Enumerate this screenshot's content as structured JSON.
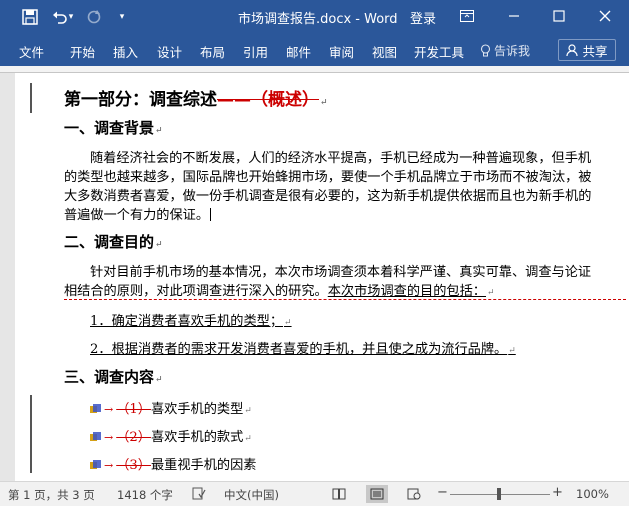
{
  "titlebar": {
    "title": "市场调查报告.docx - Word",
    "login": "登录",
    "icons": [
      "save-icon",
      "undo-icon",
      "redo-icon",
      "customize-quick-access-icon",
      "ribbon-display-options-icon",
      "minimize-icon",
      "maximize-icon",
      "close-icon"
    ],
    "undo_arrow": "▾",
    "customize_arrow": "▾"
  },
  "ribbon": {
    "tabs": [
      "文件",
      "开始",
      "插入",
      "设计",
      "布局",
      "引用",
      "邮件",
      "审阅",
      "视图",
      "开发工具"
    ],
    "tell_me": "告诉我",
    "share": "共享"
  },
  "document": {
    "heading1_main": "第一部分：调查综述",
    "heading1_deleted": "——（概述）",
    "h_background": "一、调查背景",
    "background_lines": [
      "随着经济社会的不断发展，人们的经济水平提高，手机已经成为一种普遍现象，但手机",
      "的类型也越来越多，国际品牌也开始蜂拥市场，要使一个手机品牌立于市场而不被淘汰，被",
      "大多数消费者喜爱，做一份手机调查是很有必要的，这为新手机提供依据而且也为新手机的",
      "普遍做一个有力的保证。"
    ],
    "h_purpose": "二、调查目的",
    "purpose_line1": "针对目前手机市场的基本情况，本次市场调查须本着科学严谨、真实可靠、调查与论证",
    "purpose_line2_a": "相结合的原则，对此项调查进行深入的研究。",
    "purpose_line2_b": "本次市场调查的目的包括：",
    "purpose_items": [
      "1．确定消费者喜欢手机的类型；",
      "2．根据消费者的需求开发消费者喜爱的手机，并且使之成为流行品牌。"
    ],
    "h_content": "三、调查内容",
    "content_items": [
      {
        "deleted": "（1）",
        "text": "喜欢手机的类型"
      },
      {
        "deleted": "（2）",
        "text": "喜欢手机的款式"
      },
      {
        "deleted": "（3）",
        "text": "最重视手机的因素"
      }
    ],
    "para_mark": "↵"
  },
  "statusbar": {
    "page": "第 1 页，共 3 页",
    "words": "1418 个字",
    "language": "中文(中国)",
    "zoom_minus": "−",
    "zoom_plus": "+",
    "zoom": "100%"
  }
}
